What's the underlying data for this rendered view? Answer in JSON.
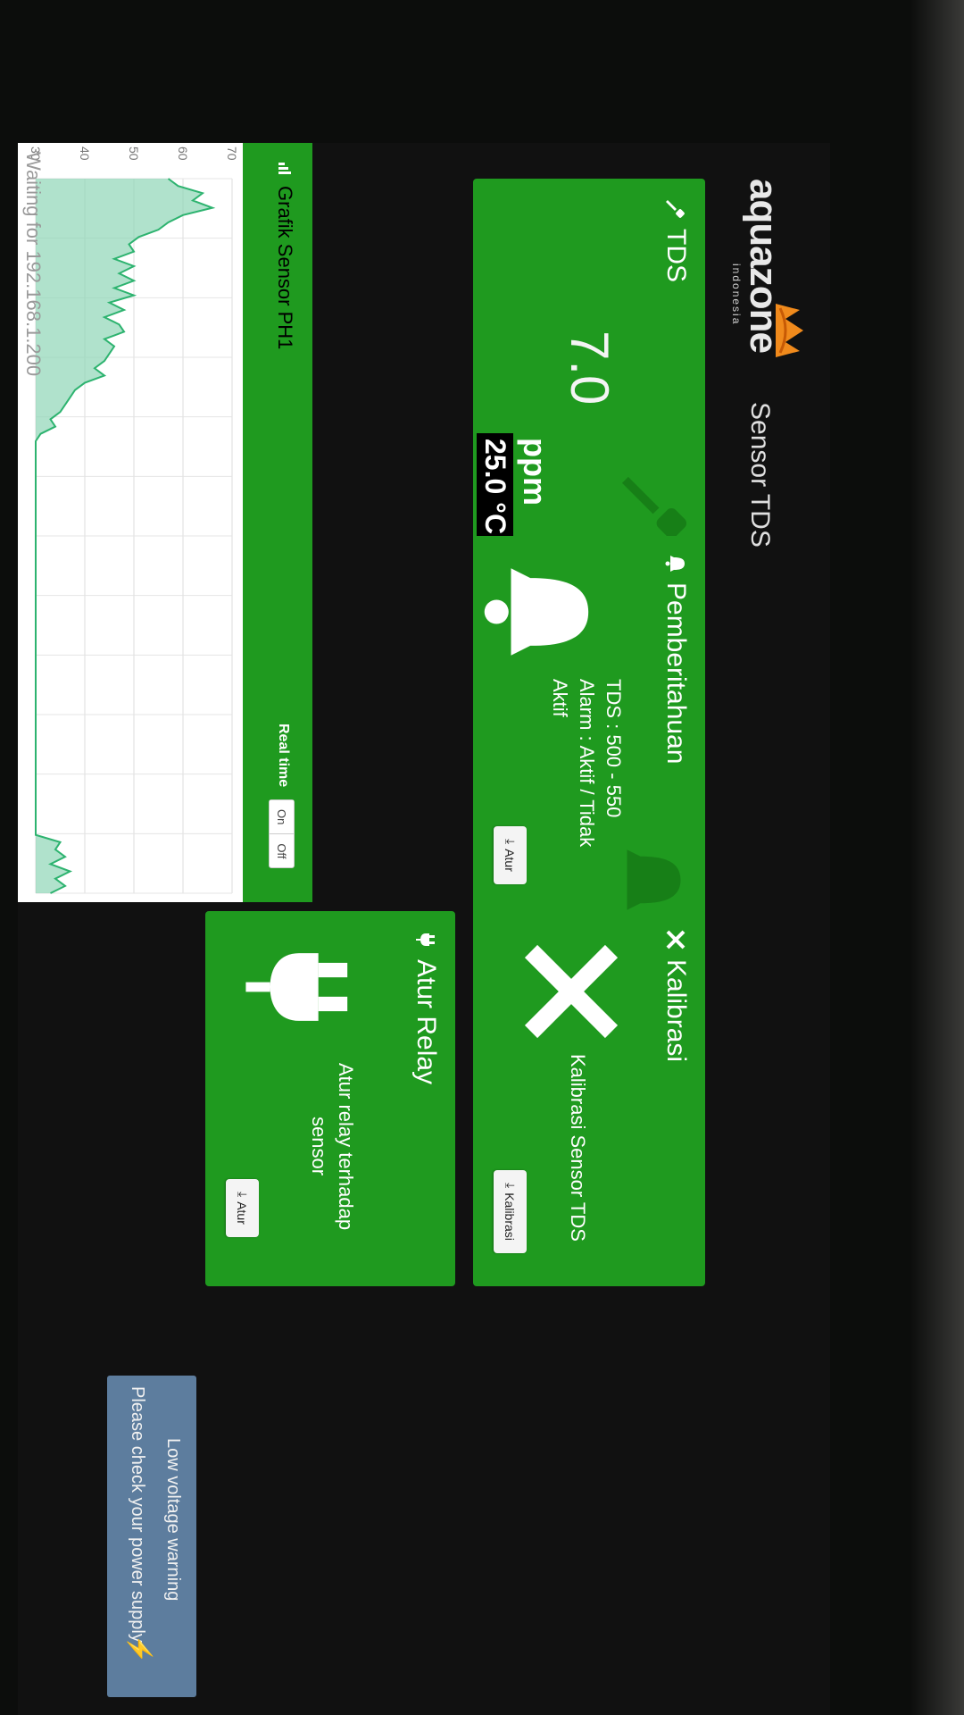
{
  "header": {
    "logo_text": "aquazone",
    "logo_sub": "indonesia",
    "page_title": "Sensor TDS"
  },
  "tds_card": {
    "title": "TDS",
    "title_icon": "dropper-icon",
    "value": "7.0",
    "unit": "ppm",
    "temperature": "25.0 °C",
    "bg_icon": "dropper-icon"
  },
  "notif_card": {
    "title": "Pemberitahuan",
    "title_icon": "bell-icon",
    "line1": "TDS : 500 - 550",
    "line2": "Alarm : Aktif / Tidak",
    "line3": "Aktif",
    "button_label": "Atur",
    "button_icon": "download-icon"
  },
  "calib_card": {
    "title": "Kalibrasi",
    "title_icon": "wrench-screwdriver-icon",
    "text": "Kalibrasi Sensor TDS",
    "button_label": "Kalibrasi",
    "button_icon": "download-icon"
  },
  "relay_card": {
    "title": "Atur Relay",
    "title_icon": "plug-icon",
    "text_line1": "Atur relay terhadap",
    "text_line2": "sensor",
    "button_label": "Atur",
    "button_icon": "download-icon"
  },
  "chart_panel": {
    "title": "Grafik Sensor PH1",
    "title_icon": "bar-chart-icon",
    "realtime_label": "Real time",
    "toggle_on": "On",
    "toggle_off": "Off",
    "waiting_text": "Waiting for 192.168.1.200"
  },
  "chart_data": {
    "type": "area",
    "y_ticks": [
      "30",
      "40",
      "50",
      "60",
      "70"
    ],
    "ylim": [
      30,
      70
    ],
    "values": [
      57,
      59,
      64,
      62,
      66,
      60,
      57,
      55,
      51,
      49,
      50,
      46,
      50,
      47,
      50,
      46,
      50,
      45,
      48,
      44,
      47,
      48,
      44,
      46,
      45,
      44,
      42,
      44,
      40,
      38,
      37,
      36,
      35,
      33,
      34,
      31,
      30,
      30,
      30,
      30,
      30,
      30,
      30,
      30,
      30,
      30,
      30,
      30,
      30,
      30,
      30,
      30,
      30,
      30,
      30,
      30,
      30,
      30,
      30,
      30,
      30,
      30,
      30,
      30,
      30,
      30,
      30,
      30,
      30,
      30,
      30,
      30,
      30,
      30,
      30,
      30,
      30,
      30,
      30,
      30,
      30,
      30,
      30,
      30,
      30,
      30,
      30,
      30,
      30,
      30,
      30,
      35,
      34,
      36,
      33,
      37,
      34,
      36,
      33
    ],
    "grid": true,
    "line_color": "#2db36f",
    "fill_color": "#8fd6b6"
  },
  "toast": {
    "title": "Low voltage warning",
    "message": "Please check your power supply",
    "icon": "lightning-icon"
  },
  "colors": {
    "card_green": "#1f9a1f",
    "toast_blue": "#5d7d9e"
  }
}
